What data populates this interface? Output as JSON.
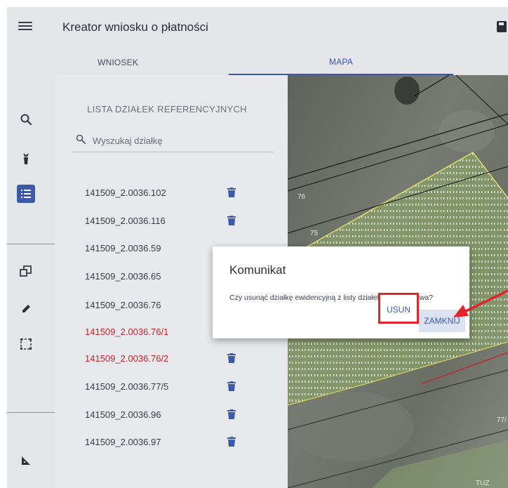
{
  "header": {
    "title": "Kreator wniosku o płatności"
  },
  "tabs": [
    {
      "label": "WNIOSEK",
      "active": false
    },
    {
      "label": "MAPA",
      "active": true
    }
  ],
  "toolbar": {
    "icons": [
      "search-icon",
      "crop-icon",
      "list-icon",
      "copy-icon",
      "pencil-icon",
      "select-area-icon",
      "measure-icon"
    ],
    "active": "list-icon"
  },
  "panel": {
    "title": "LISTA DZIAŁEK REFERENCYJNYCH",
    "search_placeholder": "Wyszukaj działkę",
    "parcels": [
      {
        "id": "141509_2.0036.102",
        "highlight": false
      },
      {
        "id": "141509_2.0036.116",
        "highlight": false
      },
      {
        "id": "141509_2.0036.59",
        "highlight": false
      },
      {
        "id": "141509_2.0036.65",
        "highlight": false
      },
      {
        "id": "141509_2.0036.76",
        "highlight": false
      },
      {
        "id": "141509_2.0036.76/1",
        "highlight": true
      },
      {
        "id": "141509_2.0036.76/2",
        "highlight": true
      },
      {
        "id": "141509_2.0036.77/5",
        "highlight": false
      },
      {
        "id": "141509_2.0036.96",
        "highlight": false
      },
      {
        "id": "141509_2.0036.97",
        "highlight": false
      }
    ]
  },
  "map": {
    "labels": [
      "76",
      "75",
      "77/",
      "TUZ"
    ]
  },
  "dialog": {
    "title": "Komunikat",
    "message": "Czy usunąć działkę ewidencyjną z listy działek gospodarstwa?",
    "confirm_label": "USUN",
    "close_label": "ZAMKNIJ"
  },
  "colors": {
    "accent": "#3d5aa8",
    "highlight_red": "#c0272d",
    "annotation_red": "#e0252b",
    "panel_bg": "#e8e9ec"
  }
}
